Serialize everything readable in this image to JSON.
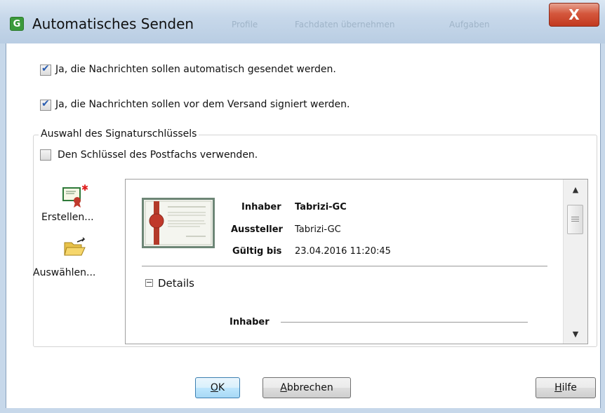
{
  "window": {
    "title": "Automatisches Senden",
    "app_icon_letter": "G",
    "close_label": "X",
    "background_titles": [
      "Profile",
      "Fachdaten übernehmen",
      "Aufgaben"
    ]
  },
  "options": {
    "auto_send": {
      "label": "Ja, die Nachrichten sollen automatisch gesendet werden.",
      "checked": true
    },
    "sign": {
      "label": "Ja, die Nachrichten sollen vor dem Versand signiert werden.",
      "checked": true
    }
  },
  "key_selection": {
    "group_title": "Auswahl des Signaturschlüssels",
    "use_mailbox_key": {
      "label": "Den Schlüssel des Postfachs verwenden.",
      "checked": false
    },
    "tools": [
      {
        "icon": "create-certificate-icon",
        "label": "Erstellen..."
      },
      {
        "icon": "open-folder-icon",
        "label": "Auswählen..."
      }
    ],
    "certificate": {
      "fields": [
        {
          "label": "Inhaber",
          "value": "Tabrizi-GC",
          "bold_value": true
        },
        {
          "label": "Aussteller",
          "value": "Tabrizi-GC",
          "bold_value": false
        },
        {
          "label": "Gültig bis",
          "value": "23.04.2016 11:20:45",
          "bold_value": false
        }
      ],
      "details_toggle": "−",
      "details_label": "Details",
      "details_first_field": "Inhaber"
    }
  },
  "buttons": {
    "ok": {
      "mnemonic": "O",
      "rest": "K"
    },
    "cancel": {
      "mnemonic": "A",
      "rest": "bbrechen"
    },
    "help": {
      "mnemonic": "H",
      "rest": "ilfe"
    }
  },
  "colors": {
    "accent_check": "#2a5db0",
    "close_red": "#c2391f",
    "seal_red": "#b33a2a"
  }
}
